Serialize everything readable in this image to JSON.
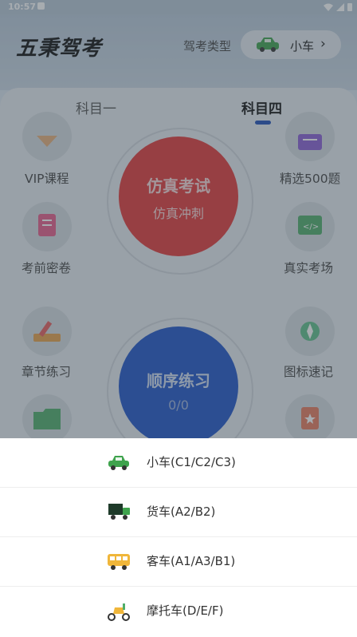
{
  "status_bar": {
    "time": "10:57"
  },
  "header": {
    "brand": "五秉驾考",
    "drive_type_label": "驾考类型",
    "vehicle": "小车"
  },
  "tabs": [
    {
      "label": "科目一"
    },
    {
      "label": "科目四"
    }
  ],
  "features": {
    "left": [
      {
        "label": "VIP课程"
      },
      {
        "label": "考前密卷"
      },
      {
        "label": "章节练习"
      }
    ],
    "right": [
      {
        "label": "精选500题"
      },
      {
        "label": "真实考场"
      },
      {
        "label": "图标速记"
      }
    ]
  },
  "exam_button": {
    "title": "仿真考试",
    "subtitle": "仿真冲刺"
  },
  "practice_button": {
    "title": "顺序练习",
    "progress": "0/0"
  },
  "vehicle_options": [
    {
      "label": "小车(C1/C2/C3)",
      "icon": "car-icon"
    },
    {
      "label": "货车(A2/B2)",
      "icon": "truck-icon"
    },
    {
      "label": "客车(A1/A3/B1)",
      "icon": "bus-icon"
    },
    {
      "label": "摩托车(D/E/F)",
      "icon": "motorcycle-icon"
    }
  ]
}
